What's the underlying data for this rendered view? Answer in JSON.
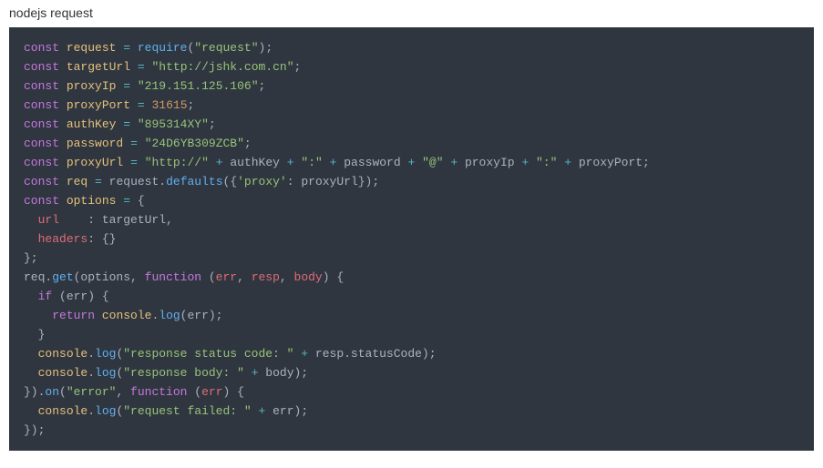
{
  "title": "nodejs request",
  "code": {
    "tokens": [
      [
        [
          "const",
          "kw"
        ],
        [
          " ",
          "pn"
        ],
        [
          "request",
          "var"
        ],
        [
          " ",
          "pn"
        ],
        [
          "=",
          "op"
        ],
        [
          " ",
          "pn"
        ],
        [
          "require",
          "fn"
        ],
        [
          "(",
          "pn"
        ],
        [
          "\"request\"",
          "str"
        ],
        [
          ");",
          "pn"
        ]
      ],
      [
        [
          "const",
          "kw"
        ],
        [
          " ",
          "pn"
        ],
        [
          "targetUrl",
          "var"
        ],
        [
          " ",
          "pn"
        ],
        [
          "=",
          "op"
        ],
        [
          " ",
          "pn"
        ],
        [
          "\"http://jshk.com.cn\"",
          "str"
        ],
        [
          ";",
          "pn"
        ]
      ],
      [
        [
          "const",
          "kw"
        ],
        [
          " ",
          "pn"
        ],
        [
          "proxyIp",
          "var"
        ],
        [
          " ",
          "pn"
        ],
        [
          "=",
          "op"
        ],
        [
          " ",
          "pn"
        ],
        [
          "\"219.151.125.106\"",
          "str"
        ],
        [
          ";",
          "pn"
        ]
      ],
      [
        [
          "const",
          "kw"
        ],
        [
          " ",
          "pn"
        ],
        [
          "proxyPort",
          "var"
        ],
        [
          " ",
          "pn"
        ],
        [
          "=",
          "op"
        ],
        [
          " ",
          "pn"
        ],
        [
          "31615",
          "num"
        ],
        [
          ";",
          "pn"
        ]
      ],
      [
        [
          "const",
          "kw"
        ],
        [
          " ",
          "pn"
        ],
        [
          "authKey",
          "var"
        ],
        [
          " ",
          "pn"
        ],
        [
          "=",
          "op"
        ],
        [
          " ",
          "pn"
        ],
        [
          "\"895314XY\"",
          "str"
        ],
        [
          ";",
          "pn"
        ]
      ],
      [
        [
          "const",
          "kw"
        ],
        [
          " ",
          "pn"
        ],
        [
          "password",
          "var"
        ],
        [
          " ",
          "pn"
        ],
        [
          "=",
          "op"
        ],
        [
          " ",
          "pn"
        ],
        [
          "\"24D6YB309ZCB\"",
          "str"
        ],
        [
          ";",
          "pn"
        ]
      ],
      [
        [
          "const",
          "kw"
        ],
        [
          " ",
          "pn"
        ],
        [
          "proxyUrl",
          "var"
        ],
        [
          " ",
          "pn"
        ],
        [
          "=",
          "op"
        ],
        [
          " ",
          "pn"
        ],
        [
          "\"http://\"",
          "str"
        ],
        [
          " ",
          "pn"
        ],
        [
          "+",
          "op"
        ],
        [
          " ",
          "pn"
        ],
        [
          "authKey",
          "pn"
        ],
        [
          " ",
          "pn"
        ],
        [
          "+",
          "op"
        ],
        [
          " ",
          "pn"
        ],
        [
          "\":\"",
          "str"
        ],
        [
          " ",
          "pn"
        ],
        [
          "+",
          "op"
        ],
        [
          " ",
          "pn"
        ],
        [
          "password",
          "pn"
        ],
        [
          " ",
          "pn"
        ],
        [
          "+",
          "op"
        ],
        [
          " ",
          "pn"
        ],
        [
          "\"@\"",
          "str"
        ],
        [
          " ",
          "pn"
        ],
        [
          "+",
          "op"
        ],
        [
          " ",
          "pn"
        ],
        [
          "proxyIp",
          "pn"
        ],
        [
          " ",
          "pn"
        ],
        [
          "+",
          "op"
        ],
        [
          " ",
          "pn"
        ],
        [
          "\":\"",
          "str"
        ],
        [
          " ",
          "pn"
        ],
        [
          "+",
          "op"
        ],
        [
          " ",
          "pn"
        ],
        [
          "proxyPort;",
          "pn"
        ]
      ],
      [
        [
          "const",
          "kw"
        ],
        [
          " ",
          "pn"
        ],
        [
          "req",
          "var"
        ],
        [
          " ",
          "pn"
        ],
        [
          "=",
          "op"
        ],
        [
          " ",
          "pn"
        ],
        [
          "request.",
          "pn"
        ],
        [
          "defaults",
          "fn"
        ],
        [
          "({",
          "pn"
        ],
        [
          "'proxy'",
          "str"
        ],
        [
          ": proxyUrl});",
          "pn"
        ]
      ],
      [
        [
          "const",
          "kw"
        ],
        [
          " ",
          "pn"
        ],
        [
          "options",
          "var"
        ],
        [
          " ",
          "pn"
        ],
        [
          "=",
          "op"
        ],
        [
          " {",
          "pn"
        ]
      ],
      [
        [
          "  ",
          "pn"
        ],
        [
          "url",
          "id"
        ],
        [
          "    : targetUrl,",
          "pn"
        ]
      ],
      [
        [
          "  ",
          "pn"
        ],
        [
          "headers",
          "id"
        ],
        [
          ": {}",
          "pn"
        ]
      ],
      [
        [
          "};",
          "pn"
        ]
      ],
      [
        [
          "req.",
          "pn"
        ],
        [
          "get",
          "fn"
        ],
        [
          "(options, ",
          "pn"
        ],
        [
          "function",
          "kw"
        ],
        [
          " (",
          "pn"
        ],
        [
          "err",
          "id"
        ],
        [
          ", ",
          "pn"
        ],
        [
          "resp",
          "id"
        ],
        [
          ", ",
          "pn"
        ],
        [
          "body",
          "id"
        ],
        [
          ") {",
          "pn"
        ]
      ],
      [
        [
          "  ",
          "pn"
        ],
        [
          "if",
          "kw"
        ],
        [
          " (err) {",
          "pn"
        ]
      ],
      [
        [
          "    ",
          "pn"
        ],
        [
          "return",
          "kw"
        ],
        [
          " ",
          "pn"
        ],
        [
          "console",
          "var"
        ],
        [
          ".",
          "pn"
        ],
        [
          "log",
          "fn"
        ],
        [
          "(err);",
          "pn"
        ]
      ],
      [
        [
          "  }",
          "pn"
        ]
      ],
      [
        [
          "  ",
          "pn"
        ],
        [
          "console",
          "var"
        ],
        [
          ".",
          "pn"
        ],
        [
          "log",
          "fn"
        ],
        [
          "(",
          "pn"
        ],
        [
          "\"response status code: \"",
          "str"
        ],
        [
          " ",
          "pn"
        ],
        [
          "+",
          "op"
        ],
        [
          " resp.statusCode);",
          "pn"
        ]
      ],
      [
        [
          "  ",
          "pn"
        ],
        [
          "console",
          "var"
        ],
        [
          ".",
          "pn"
        ],
        [
          "log",
          "fn"
        ],
        [
          "(",
          "pn"
        ],
        [
          "\"response body: \"",
          "str"
        ],
        [
          " ",
          "pn"
        ],
        [
          "+",
          "op"
        ],
        [
          " body);",
          "pn"
        ]
      ],
      [
        [
          "}).",
          "pn"
        ],
        [
          "on",
          "fn"
        ],
        [
          "(",
          "pn"
        ],
        [
          "\"error\"",
          "str"
        ],
        [
          ", ",
          "pn"
        ],
        [
          "function",
          "kw"
        ],
        [
          " (",
          "pn"
        ],
        [
          "err",
          "id"
        ],
        [
          ") {",
          "pn"
        ]
      ],
      [
        [
          "  ",
          "pn"
        ],
        [
          "console",
          "var"
        ],
        [
          ".",
          "pn"
        ],
        [
          "log",
          "fn"
        ],
        [
          "(",
          "pn"
        ],
        [
          "\"request failed: \"",
          "str"
        ],
        [
          " ",
          "pn"
        ],
        [
          "+",
          "op"
        ],
        [
          " err);",
          "pn"
        ]
      ],
      [
        [
          "});",
          "pn"
        ]
      ]
    ]
  }
}
